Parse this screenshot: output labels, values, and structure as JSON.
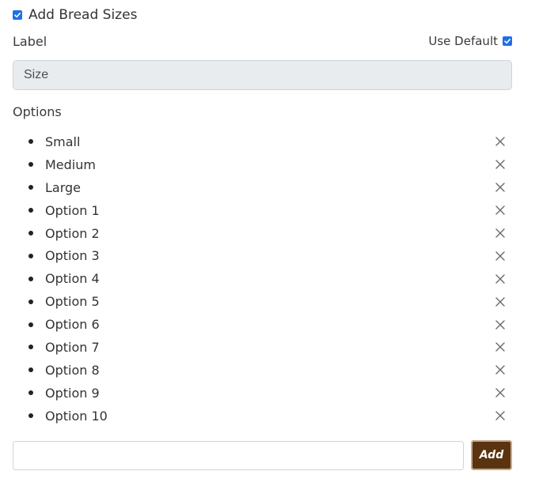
{
  "header": {
    "title": "Add Bread Sizes",
    "enabled": true
  },
  "label_field": {
    "label": "Label",
    "use_default_label": "Use Default",
    "use_default_checked": true,
    "value": "Size"
  },
  "options": {
    "heading": "Options",
    "items": [
      {
        "label": "Small"
      },
      {
        "label": "Medium"
      },
      {
        "label": "Large"
      },
      {
        "label": "Option 1"
      },
      {
        "label": "Option 2"
      },
      {
        "label": "Option 3"
      },
      {
        "label": "Option 4"
      },
      {
        "label": "Option 5"
      },
      {
        "label": "Option 6"
      },
      {
        "label": "Option 7"
      },
      {
        "label": "Option 8"
      },
      {
        "label": "Option 9"
      },
      {
        "label": "Option 10"
      }
    ],
    "remove_icon": "close-icon"
  },
  "add_option": {
    "input_value": "",
    "placeholder": "",
    "button_label": "Add"
  },
  "colors": {
    "checkbox": "#1f6fe6",
    "add_button_bg": "#5a3410",
    "input_disabled_bg": "#e9ecef"
  }
}
